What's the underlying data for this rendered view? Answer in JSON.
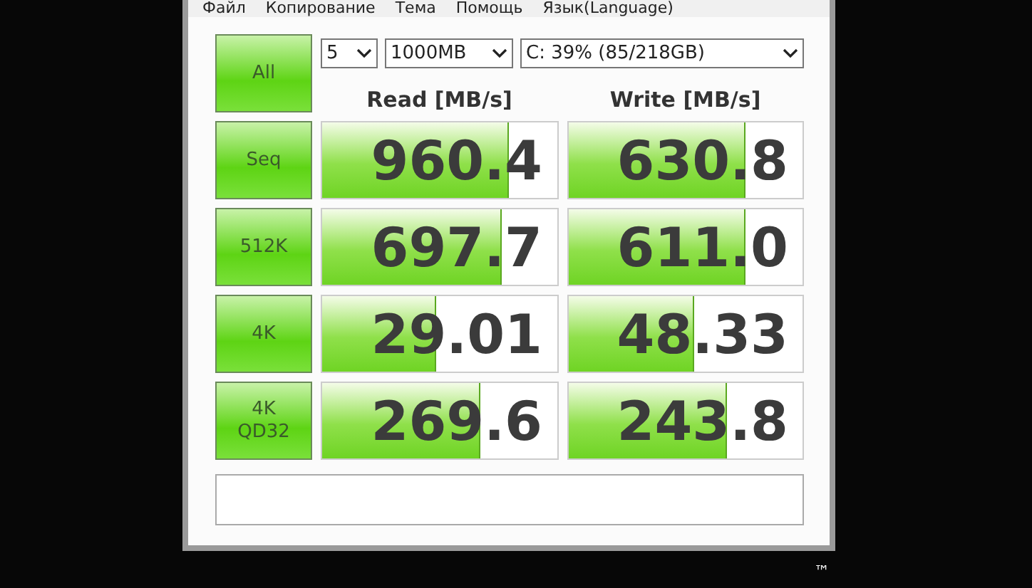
{
  "menu": [
    "Файл",
    "Копирование",
    "Тема",
    "Помощь",
    "Язык(Language)"
  ],
  "all_button": "All",
  "selects": [
    {
      "kind": "count",
      "value": "5"
    },
    {
      "kind": "size",
      "value": "1000MB"
    },
    {
      "kind": "drive",
      "value": "C: 39% (85/218GB)"
    }
  ],
  "headers": [
    "Read [MB/s]",
    "Write [MB/s]"
  ],
  "rows": [
    {
      "label": "Seq",
      "read": {
        "value": "960.4",
        "level": 0.79
      },
      "write": {
        "value": "630.8",
        "level": 0.75
      }
    },
    {
      "label": "512K",
      "read": {
        "value": "697.7",
        "level": 0.76
      },
      "write": {
        "value": "611.0",
        "level": 0.75
      }
    },
    {
      "label": "4K",
      "read": {
        "value": "29.01",
        "level": 0.48
      },
      "write": {
        "value": "48.33",
        "level": 0.53
      }
    },
    {
      "label": "4K\nQD32",
      "read": {
        "value": "269.6",
        "level": 0.67
      },
      "write": {
        "value": "243.8",
        "level": 0.67
      }
    }
  ],
  "logo": {
    "mark": "™"
  }
}
